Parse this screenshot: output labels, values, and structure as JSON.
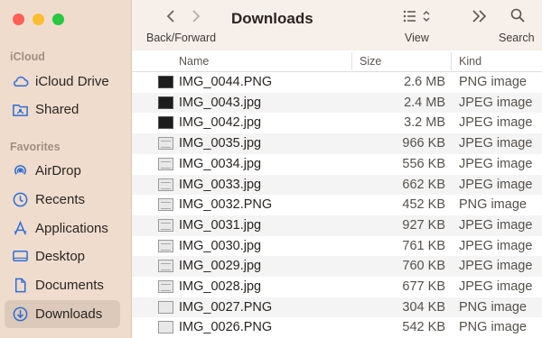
{
  "sidebar": {
    "icloud_heading": "iCloud",
    "favorites_heading": "Favorites",
    "items": [
      {
        "label": "iCloud Drive",
        "icon": "cloud-icon"
      },
      {
        "label": "Shared",
        "icon": "shared-folder-icon"
      },
      {
        "label": "AirDrop",
        "icon": "airdrop-icon"
      },
      {
        "label": "Recents",
        "icon": "clock-icon"
      },
      {
        "label": "Applications",
        "icon": "applications-icon"
      },
      {
        "label": "Desktop",
        "icon": "desktop-icon"
      },
      {
        "label": "Documents",
        "icon": "document-icon"
      },
      {
        "label": "Downloads",
        "icon": "download-icon",
        "selected": true
      }
    ]
  },
  "toolbar": {
    "title": "Downloads",
    "back_forward_label": "Back/Forward",
    "view_label": "View",
    "search_label": "Search"
  },
  "columns": {
    "name": "Name",
    "size": "Size",
    "kind": "Kind"
  },
  "files": [
    {
      "name": "IMG_0044.PNG",
      "size": "2.6 MB",
      "kind": "PNG image"
    },
    {
      "name": "IMG_0043.jpg",
      "size": "2.4 MB",
      "kind": "JPEG image"
    },
    {
      "name": "IMG_0042.jpg",
      "size": "3.2 MB",
      "kind": "JPEG image"
    },
    {
      "name": "IMG_0035.jpg",
      "size": "966 KB",
      "kind": "JPEG image"
    },
    {
      "name": "IMG_0034.jpg",
      "size": "556 KB",
      "kind": "JPEG image"
    },
    {
      "name": "IMG_0033.jpg",
      "size": "662 KB",
      "kind": "JPEG image"
    },
    {
      "name": "IMG_0032.PNG",
      "size": "452 KB",
      "kind": "PNG image"
    },
    {
      "name": "IMG_0031.jpg",
      "size": "927 KB",
      "kind": "JPEG image"
    },
    {
      "name": "IMG_0030.jpg",
      "size": "761 KB",
      "kind": "JPEG image"
    },
    {
      "name": "IMG_0029.jpg",
      "size": "760 KB",
      "kind": "JPEG image"
    },
    {
      "name": "IMG_0028.jpg",
      "size": "677 KB",
      "kind": "JPEG image"
    },
    {
      "name": "IMG_0027.PNG",
      "size": "304 KB",
      "kind": "PNG image"
    },
    {
      "name": "IMG_0026.PNG",
      "size": "542 KB",
      "kind": "PNG image"
    }
  ],
  "colors": {
    "sidebar_bg": "#efdccd",
    "selected_bg": "#dcc9b9",
    "accent": "#2d6fd6"
  }
}
